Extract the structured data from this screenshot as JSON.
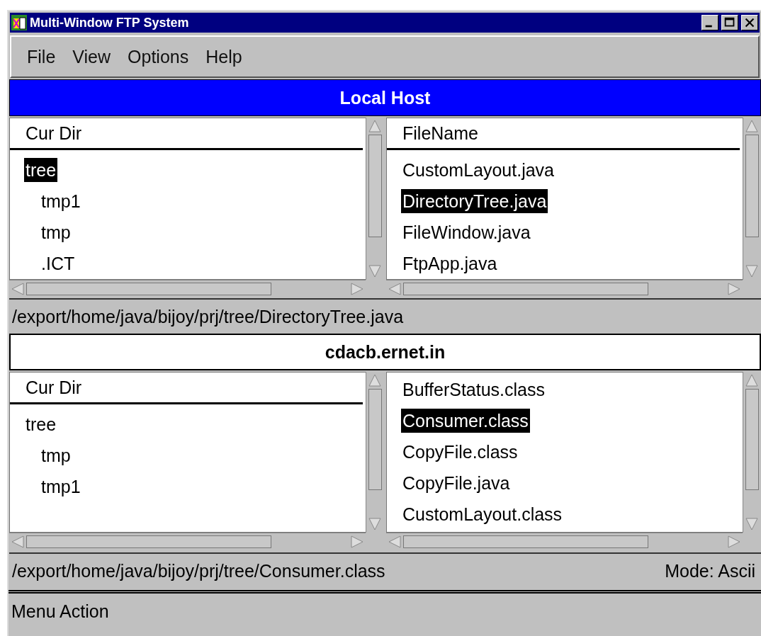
{
  "window": {
    "title": "Multi-Window FTP System"
  },
  "menu": [
    "File",
    "View",
    "Options",
    "Help"
  ],
  "hosts": [
    {
      "name": "Local Host",
      "active": true,
      "dir_header": "Cur Dir",
      "file_header": "FileName",
      "dirs": [
        {
          "name": "tree",
          "selected": true,
          "children": [
            {
              "name": "tmp1",
              "selected": false
            },
            {
              "name": "tmp",
              "selected": false
            },
            {
              "name": ".ICT",
              "selected": false
            }
          ]
        }
      ],
      "files": [
        {
          "name": "CustomLayout.java",
          "selected": false
        },
        {
          "name": "DirectoryTree.java",
          "selected": true
        },
        {
          "name": "FileWindow.java",
          "selected": false
        },
        {
          "name": "FtpApp.java",
          "selected": false
        }
      ],
      "path": "/export/home/java/bijoy/prj/tree/DirectoryTree.java"
    },
    {
      "name": "cdacb.ernet.in",
      "active": false,
      "dir_header": "Cur Dir",
      "dirs": [
        {
          "name": "tree",
          "selected": false,
          "children": [
            {
              "name": "tmp",
              "selected": false
            },
            {
              "name": "tmp1",
              "selected": false
            }
          ]
        }
      ],
      "files": [
        {
          "name": "BufferStatus.class",
          "selected": false
        },
        {
          "name": "Consumer.class",
          "selected": true
        },
        {
          "name": "CopyFile.class",
          "selected": false
        },
        {
          "name": "CopyFile.java",
          "selected": false
        },
        {
          "name": "CustomLayout.class",
          "selected": false
        }
      ],
      "path": "/export/home/java/bijoy/prj/tree/Consumer.class",
      "mode": "Mode: Ascii"
    }
  ],
  "status_bar": "Menu Action"
}
